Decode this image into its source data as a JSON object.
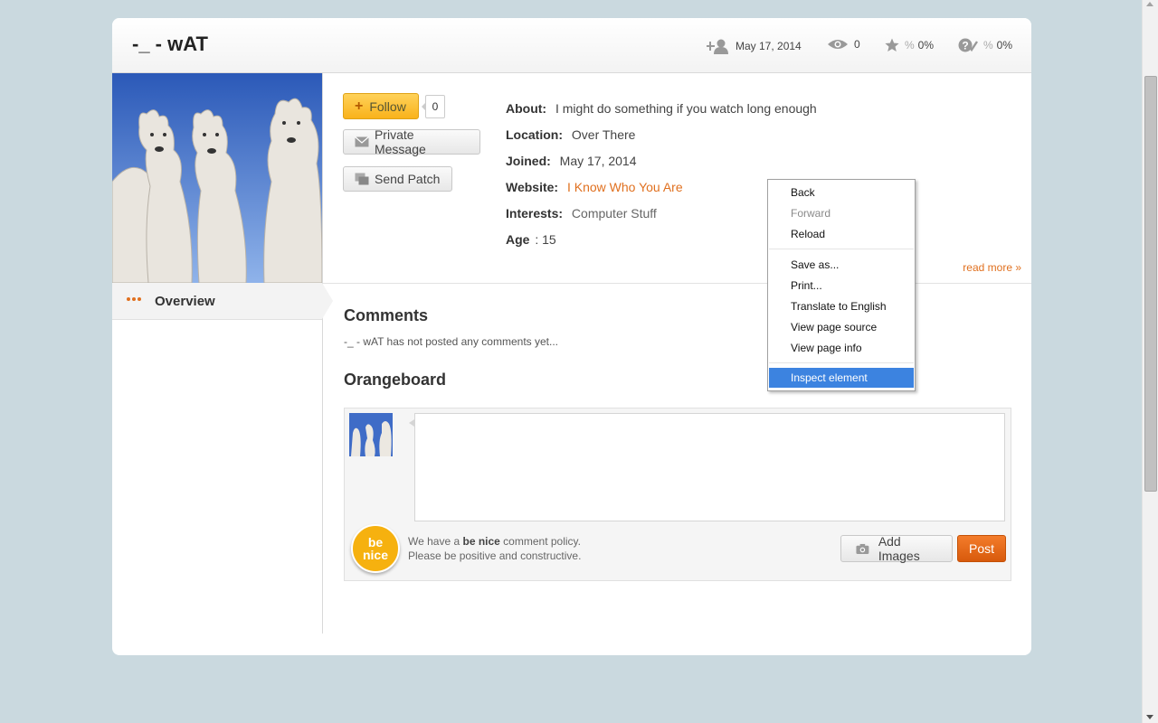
{
  "header": {
    "title": "-_ - wAT",
    "joined_stat": "May 17, 2014",
    "views_stat": "0",
    "favorite_stat": "0%",
    "favorite_prefix": "%",
    "accepted_stat": "0%",
    "accepted_prefix": "%"
  },
  "actions": {
    "follow_label": "Follow",
    "follow_count": "0",
    "private_message_label": "Private Message",
    "send_patch_label": "Send Patch"
  },
  "profile_info": {
    "about_label": "About:",
    "about_value": "I might do something if you watch long enough",
    "location_label": "Location:",
    "location_value": "Over There",
    "joined_label": "Joined:",
    "joined_value": "May 17, 2014",
    "website_label": "Website:",
    "website_value": "I Know Who You Are",
    "interests_label": "Interests:",
    "interests_value": "Computer Stuff",
    "age_label": "Age",
    "age_value": ": 15",
    "read_more": "read more »"
  },
  "sidebar": {
    "overview_label": "Overview"
  },
  "comments": {
    "heading": "Comments",
    "empty_text": "-_ - wAT has not posted any comments yet..."
  },
  "orangeboard": {
    "heading": "Orangeboard",
    "textarea_placeholder": "",
    "badge_line1": "be",
    "badge_line2": "nice",
    "policy_pre": "We have a ",
    "policy_bold": "be nice",
    "policy_post": " comment policy.",
    "policy_line2": "Please be positive and constructive.",
    "add_images_label": "Add Images",
    "post_label": "Post"
  },
  "context_menu": {
    "items": [
      {
        "label": "Back",
        "disabled": false
      },
      {
        "label": "Forward",
        "disabled": true
      },
      {
        "label": "Reload",
        "disabled": false
      },
      {
        "label": "Save as...",
        "disabled": false
      },
      {
        "label": "Print...",
        "disabled": false
      },
      {
        "label": "Translate to English",
        "disabled": false
      },
      {
        "label": "View page source",
        "disabled": false
      },
      {
        "label": "View page info",
        "disabled": false
      },
      {
        "label": "Inspect element",
        "disabled": false,
        "selected": true
      }
    ]
  },
  "colors": {
    "accent_orange": "#e0701f",
    "follow_yellow": "#f9b21b",
    "post_orange": "#d85a0c",
    "menu_highlight": "#3c83e0",
    "page_background": "#cad9df"
  }
}
